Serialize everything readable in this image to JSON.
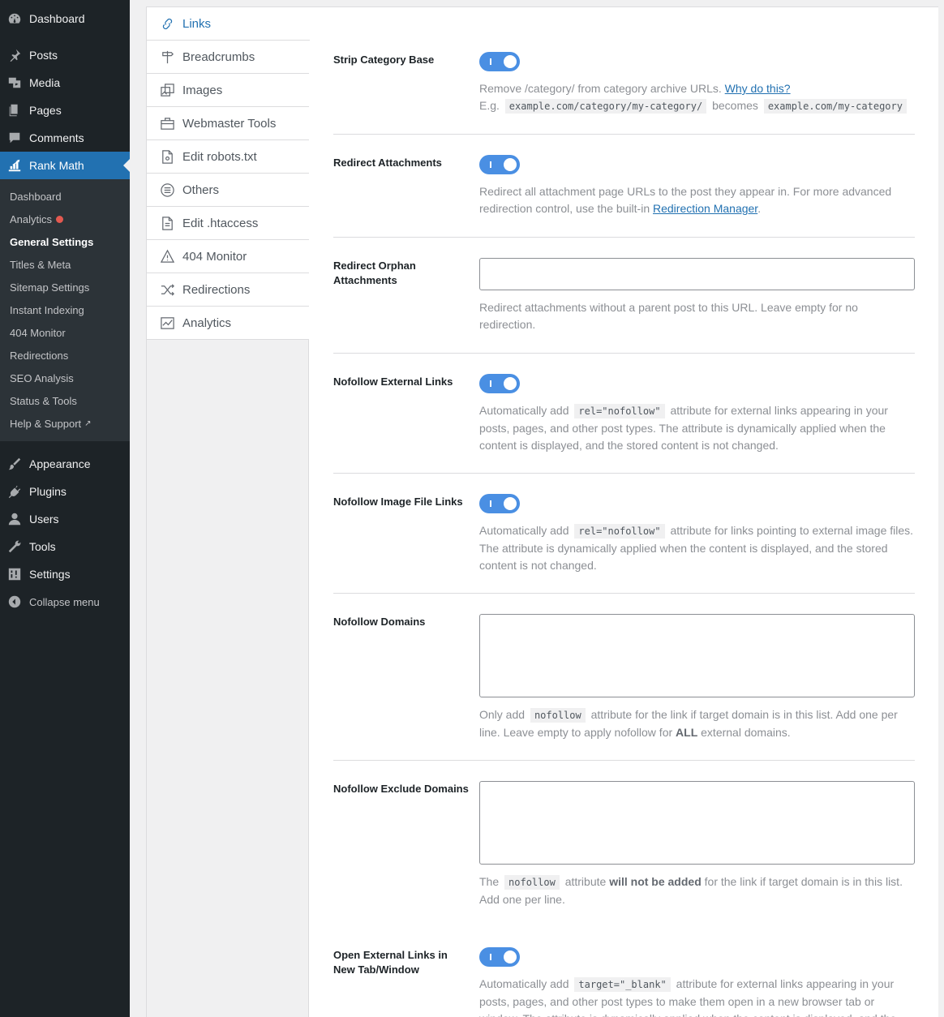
{
  "sidebar": {
    "dashboard": "Dashboard",
    "posts": "Posts",
    "media": "Media",
    "pages": "Pages",
    "comments": "Comments",
    "rank_math": "Rank Math",
    "submenu": {
      "dashboard": "Dashboard",
      "analytics": "Analytics",
      "general_settings": "General Settings",
      "titles_meta": "Titles & Meta",
      "sitemap_settings": "Sitemap Settings",
      "instant_indexing": "Instant Indexing",
      "monitor_404": "404 Monitor",
      "redirections": "Redirections",
      "seo_analysis": "SEO Analysis",
      "status_tools": "Status & Tools",
      "help_support": "Help & Support"
    },
    "appearance": "Appearance",
    "plugins": "Plugins",
    "users": "Users",
    "tools": "Tools",
    "settings": "Settings",
    "collapse": "Collapse menu"
  },
  "tabs": {
    "links": "Links",
    "breadcrumbs": "Breadcrumbs",
    "images": "Images",
    "webmaster_tools": "Webmaster Tools",
    "edit_robots": "Edit robots.txt",
    "others": "Others",
    "edit_htaccess": "Edit .htaccess",
    "monitor_404": "404 Monitor",
    "redirections": "Redirections",
    "analytics": "Analytics"
  },
  "fields": {
    "strip_category": {
      "label": "Strip Category Base",
      "enabled": true,
      "desc": "Remove /category/ from category archive URLs. ",
      "link": "Why do this?",
      "eg": "E.g.",
      "code1": "example.com/category/my-category/",
      "becomes": "becomes",
      "code2": "example.com/my-category"
    },
    "redirect_attachments": {
      "label": "Redirect Attachments",
      "enabled": true,
      "desc": "Redirect all attachment page URLs to the post they appear in. For more advanced redirection control, use the built-in ",
      "link": "Redirection Manager",
      "end": "."
    },
    "redirect_orphan": {
      "label": "Redirect Orphan Attachments",
      "value": "",
      "desc": "Redirect attachments without a parent post to this URL. Leave empty for no redirection."
    },
    "nofollow_external": {
      "label": "Nofollow External Links",
      "enabled": true,
      "pre": "Automatically add",
      "code": "rel=\"nofollow\"",
      "post": "attribute for external links appearing in your posts, pages, and other post types. The attribute is dynamically applied when the content is displayed, and the stored content is not changed."
    },
    "nofollow_image": {
      "label": "Nofollow Image File Links",
      "enabled": true,
      "pre": "Automatically add",
      "code": "rel=\"nofollow\"",
      "post": "attribute for links pointing to external image files. The attribute is dynamically applied when the content is displayed, and the stored content is not changed."
    },
    "nofollow_domains": {
      "label": "Nofollow Domains",
      "value": "",
      "pre": "Only add",
      "code": "nofollow",
      "mid": "attribute for the link if target domain is in this list. Add one per line. Leave empty to apply nofollow for ",
      "bold": "ALL",
      "post": " external domains."
    },
    "nofollow_exclude": {
      "label": "Nofollow Exclude Domains",
      "value": "",
      "pre": "The",
      "code": "nofollow",
      "mid": "attribute ",
      "bold": "will not be added",
      "post": " for the link if target domain is in this list. Add one per line."
    },
    "open_external": {
      "label": "Open External Links in New Tab/Window",
      "enabled": true,
      "pre": "Automatically add",
      "code": "target=\"_blank\"",
      "post": "attribute for external links appearing in your posts, pages, and other post types to make them open in a new browser tab or window. The attribute is dynamically applied when the content is displayed, and the stored content is not changed."
    }
  }
}
